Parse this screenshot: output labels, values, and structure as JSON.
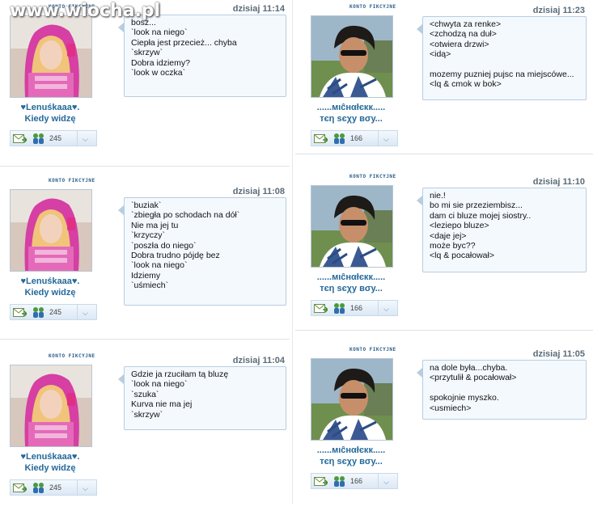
{
  "watermark": "www.wiocha.pl",
  "left_user": {
    "name1": "♥Lenuśkaaa♥.",
    "name2": "Kiedy widzę",
    "badge": "KONTO FIKCYJNE",
    "count": "245"
  },
  "right_user": {
    "name1": "......мιĉнαłєкк.....",
    "name2": "тєη ѕєχу вσу...",
    "badge": "KONTO FIKCYJNE",
    "count": "166"
  },
  "messages_left": [
    {
      "time": "dzisiaj 11:14",
      "lines": [
        "bosz...",
        "`look na niego`",
        "Ciepła jest przecież... chyba",
        "`skrzyw`",
        "Dobra idziemy?",
        "`look w oczka`"
      ]
    },
    {
      "time": "dzisiaj 11:08",
      "lines": [
        "`buziak`",
        "`zbiegła po schodach na dół`",
        "Nie ma jej tu",
        "`krzyczy`",
        "`poszła do niego`",
        "Dobra trudno pójdę bez",
        "`look na niego`",
        "Idziemy",
        "`uśmiech`"
      ]
    },
    {
      "time": "dzisiaj 11:04",
      "lines": [
        "Gdzie ja rzuciłam tą bluzę",
        "`look na niego`",
        "`szuka`",
        "Kurva nie ma jej",
        "`skrzyw`"
      ]
    }
  ],
  "messages_right": [
    {
      "time": "dzisiaj 11:23",
      "lines": [
        "<chwyta za renke>",
        "<zchodzą na duł>",
        "<otwiera drzwi>",
        "<idą>",
        "",
        "mozemy puzniej pujsc na miejscówe...",
        "<lq & cmok w bok>"
      ]
    },
    {
      "time": "dzisiaj 11:10",
      "lines": [
        "nie.!",
        "bo mi sie przeziembisz...",
        "dam ci bluze mojej siostry..",
        "<leziepo bluze>",
        "<daje jej>",
        "może byc??",
        "<lq & pocałował>"
      ]
    },
    {
      "time": "dzisiaj 11:05",
      "lines": [
        "na dole była...chyba.",
        "<przytulił & pocałował>",
        "",
        "spokojnie myszko.",
        "<usmiech>"
      ]
    }
  ],
  "colors": {
    "accent": "#24699a",
    "bubble_bg": "#f4f9fe",
    "bubble_border": "#b7cde0"
  }
}
